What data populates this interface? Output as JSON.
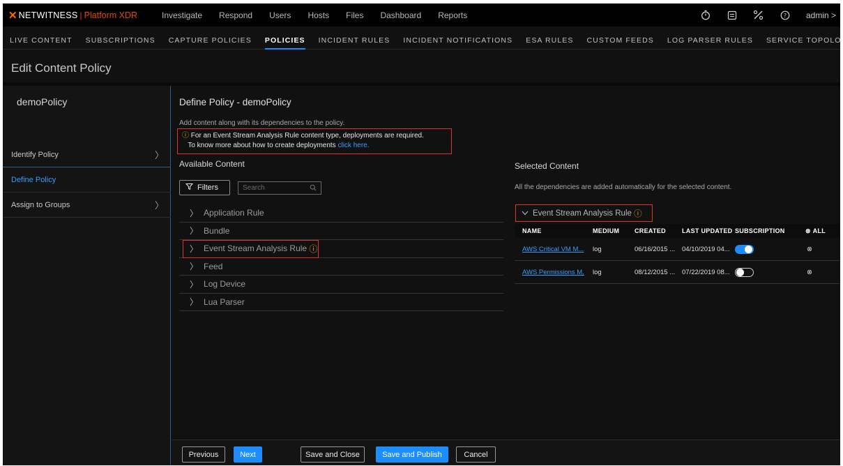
{
  "brand": {
    "name": "NETWITNESS",
    "separator": "|",
    "product": "Platform XDR",
    "accent": "#e04a00"
  },
  "main_nav": [
    "Investigate",
    "Respond",
    "Users",
    "Hosts",
    "Files",
    "Dashboard",
    "Reports"
  ],
  "top_right": {
    "icons": [
      "stopwatch-icon",
      "notes-icon",
      "tools-icon",
      "help-icon"
    ],
    "user": "admin >"
  },
  "sub_nav": [
    "LIVE CONTENT",
    "SUBSCRIPTIONS",
    "CAPTURE POLICIES",
    "POLICIES",
    "INCIDENT RULES",
    "INCIDENT NOTIFICATIONS",
    "ESA RULES",
    "CUSTOM FEEDS",
    "LOG PARSER RULES",
    "SERVICE TOPOLOGY"
  ],
  "sub_nav_active": "POLICIES",
  "page_title": "Edit Content Policy",
  "left_panel": {
    "policy_name": "demoPolicy",
    "steps": [
      "Identify Policy",
      "Define Policy",
      "Assign to Groups"
    ]
  },
  "define": {
    "title": "Define Policy - demoPolicy",
    "description": "Add content along with its dependencies to the policy.",
    "warning_line1": "For an Event Stream Analysis Rule content type, deployments are required.",
    "warning_line2": "To know more about how to create deployments ",
    "warning_link": "click here."
  },
  "available": {
    "title": "Available Content",
    "filters_label": "Filters",
    "search_placeholder": "Search",
    "items": [
      "Application Rule",
      "Bundle",
      "Event Stream Analysis Rule",
      "Feed",
      "Log Device",
      "Lua Parser"
    ]
  },
  "selected": {
    "title": "Selected Content",
    "description": "All the dependencies are added automatically for the selected content.",
    "group": "Event Stream Analysis Rule",
    "columns": [
      "NAME",
      "MEDIUM",
      "CREATED",
      "LAST UPDATED",
      "SUBSCRIPTION",
      "ALL"
    ],
    "rows": [
      {
        "name": "AWS Critical VM M...",
        "medium": "log",
        "created": "06/16/2015 ...",
        "updated": "04/10/2019 04...",
        "subscribed": true
      },
      {
        "name": "AWS Permissions M...",
        "medium": "log",
        "created": "08/12/2015 ...",
        "updated": "07/22/2019 08...",
        "subscribed": false
      }
    ]
  },
  "footer": {
    "previous": "Previous",
    "next": "Next",
    "save_close": "Save and Close",
    "save_publish": "Save and Publish",
    "cancel": "Cancel"
  },
  "colors": {
    "accent_blue": "#1c8dff",
    "warning": "#f5a623",
    "highlight_red": "#e03030"
  }
}
